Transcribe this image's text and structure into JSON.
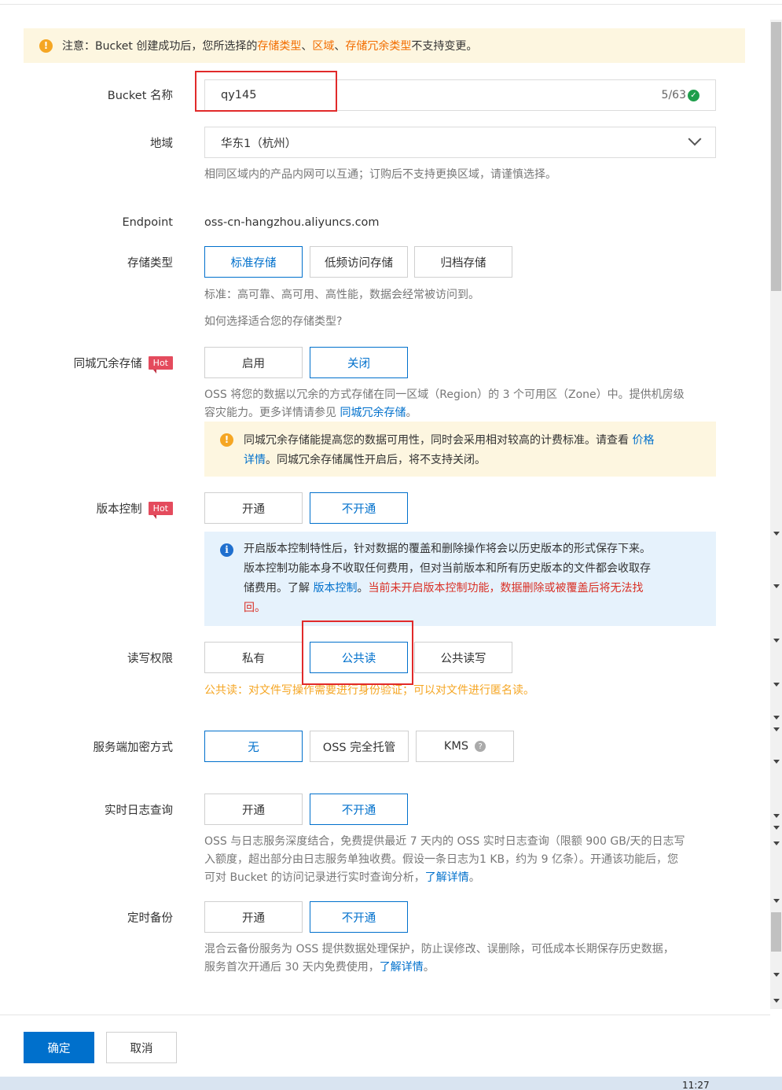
{
  "notice": {
    "prefix": "注意：Bucket 创建成功后，您所选择的 ",
    "item1": "存储类型",
    "sep1": "、",
    "item2": "区域",
    "sep2": "、",
    "item3": "存储冗余类型",
    "suffix": " 不支持变更。"
  },
  "bucket_name": {
    "label": "Bucket 名称",
    "value": "qy145",
    "counter": "5/63"
  },
  "region": {
    "label": "地域",
    "value": "华东1（杭州）",
    "help": "相同区域内的产品内网可以互通；订购后不支持更换区域，请谨慎选择。"
  },
  "endpoint": {
    "label": "Endpoint",
    "value": "oss-cn-hangzhou.aliyuncs.com"
  },
  "storage_type": {
    "label": "存储类型",
    "options": [
      "标准存储",
      "低频访问存储",
      "归档存储"
    ],
    "selected": "标准存储",
    "help": "标准：高可靠、高可用、高性能，数据会经常被访问到。",
    "link": "如何选择适合您的存储类型?"
  },
  "zone_redundancy": {
    "label": "同城冗余存储",
    "hot": "Hot",
    "options": [
      "启用",
      "关闭"
    ],
    "selected": "关闭",
    "help_line1": "OSS 将您的数据以冗余的方式存储在同一区域（Region）的 3 个可用区（Zone）中。提供机房级",
    "help_line2_prefix": "容灾能力。更多详情请参见 ",
    "help_link": "同城冗余存储",
    "help_end": "。",
    "alert_text1": "同城冗余存储能提高您的数据可用性，同时会采用相对较高的计费标准。请查看 ",
    "alert_link1": "价格",
    "alert_link2": "详情",
    "alert_text2": "。同城冗余存储属性开启后，将不支持关闭。"
  },
  "versioning": {
    "label": "版本控制",
    "hot": "Hot",
    "options": [
      "开通",
      "不开通"
    ],
    "selected": "不开通",
    "alert_line1": "开启版本控制特性后，针对数据的覆盖和删除操作将会以历史版本的形式保存下来。",
    "alert_line2": "版本控制功能本身不收取任何费用，但对当前版本和所有历史版本的文件都会收取存",
    "alert_line3_prefix": "储费用。了解 ",
    "alert_link": "版本控制",
    "alert_line3_mid": "。",
    "alert_red": "当前未开启版本控制功能，数据删除或被覆盖后将无法找",
    "alert_red2": "回。"
  },
  "acl": {
    "label": "读写权限",
    "options": [
      "私有",
      "公共读",
      "公共读写"
    ],
    "selected": "公共读",
    "warning": "公共读：对文件写操作需要进行身份验证；可以对文件进行匿名读。"
  },
  "encryption": {
    "label": "服务端加密方式",
    "options": [
      "无",
      "OSS 完全托管",
      "KMS"
    ],
    "selected": "无"
  },
  "realtime_log": {
    "label": "实时日志查询",
    "options": [
      "开通",
      "不开通"
    ],
    "selected": "不开通",
    "help_line1": "OSS 与日志服务深度结合，免费提供最近 7 天内的 OSS 实时日志查询（限额 900 GB/天的日志写",
    "help_line2": "入额度，超出部分由日志服务单独收费。假设一条日志为1 KB，约为 9 亿条）。开通该功能后，您",
    "help_line3_prefix": "可对 Bucket 的访问记录进行实时查询分析，",
    "help_link": "了解详情",
    "help_end": "。"
  },
  "scheduled_backup": {
    "label": "定时备份",
    "options": [
      "开通",
      "不开通"
    ],
    "selected": "不开通",
    "help_line1": "混合云备份服务为 OSS 提供数据处理保护，防止误修改、误删除，可低成本长期保存历史数据，",
    "help_line2_prefix": "服务首次开通后 30 天内免费使用，",
    "help_link": "了解详情",
    "help_end": "。"
  },
  "footer": {
    "confirm": "确定",
    "cancel": "取消"
  },
  "taskbar": {
    "clock": "11:27"
  },
  "colors": {
    "accent": "#0070cc",
    "hot": "#e44b5d",
    "warning_text": "#f5a623",
    "highlight": "#e12a2a"
  }
}
